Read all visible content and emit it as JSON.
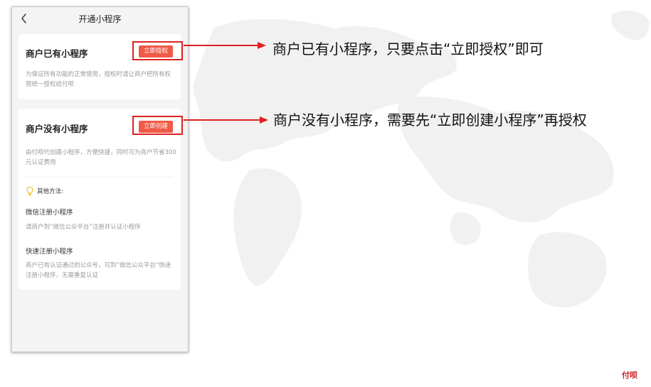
{
  "mini_program_screen": {
    "nav": {
      "title": "开通小程序"
    },
    "existing": {
      "title": "商户已有小程序",
      "button_label": "立即授权",
      "description": "为保证所有功能的正常使用，授权时请让商户把所有权限统一授权给付呗"
    },
    "create": {
      "title": "商户没有小程序",
      "button_label": "立即创建",
      "description": "由付呗代创建小程序，方便快捷，同时可为商户节省300元认证费用"
    },
    "other_methods": {
      "label": "其他方法:",
      "methods": [
        {
          "title": "微信注册小程序",
          "description": "请商户到“微信公众平台”注册并认证小程序"
        },
        {
          "title": "快速注册小程序",
          "description": "商户已有认证通过的公众号，可到“微信公众平台”快速注册小程序，无需重复认证"
        }
      ]
    }
  },
  "annotations": {
    "existing": "商户已有小程序，只要点击“立即授权”即可",
    "create": "商户没有小程序，需要先“立即创建小程序”再授权"
  },
  "brand": {
    "logo_text": "付呗",
    "accent_color": "#f05a46",
    "highlight_color": "#e02020"
  },
  "icons": {
    "back": "chevron-left-icon",
    "tip": "lightbulb-icon"
  }
}
